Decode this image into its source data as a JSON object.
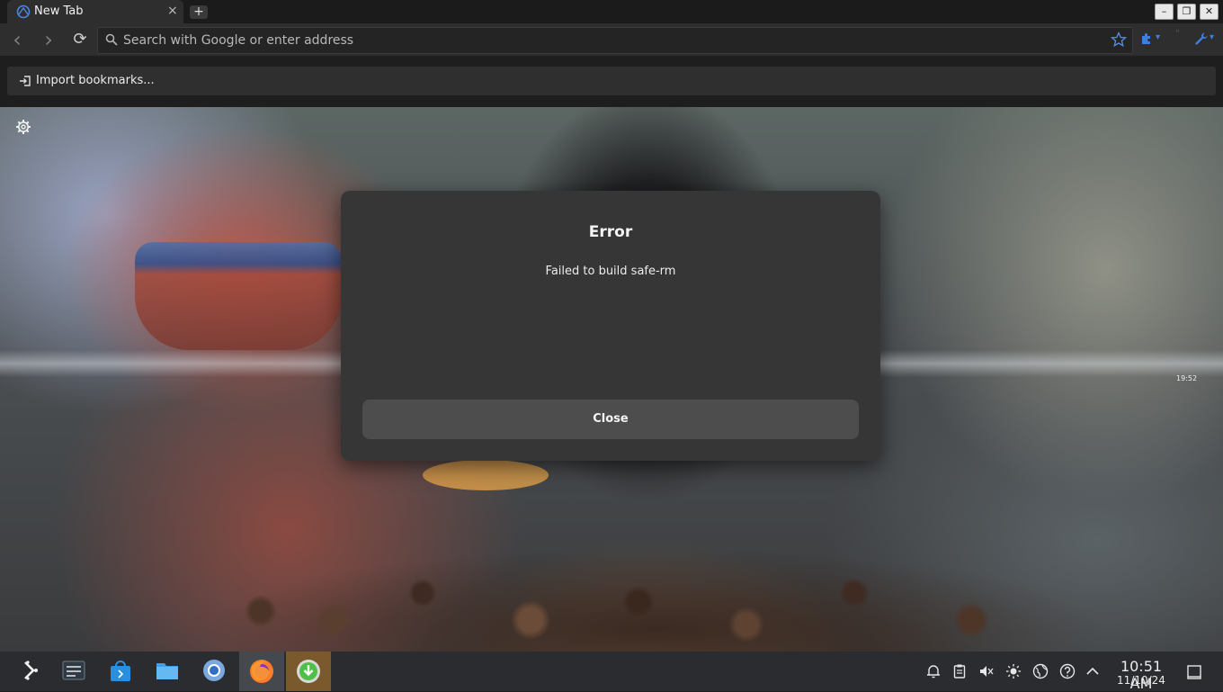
{
  "browser": {
    "tab": {
      "title": "New Tab",
      "close": "×"
    },
    "new_tab_label": "+",
    "window_controls": {
      "minimize": "–",
      "restore": "❐",
      "close": "✕"
    },
    "nav": {
      "back": "‹",
      "forward": "›",
      "reload": "⟳"
    },
    "address_bar": {
      "placeholder": "Search with Google or enter address",
      "value": ""
    },
    "extensions": {
      "puzzle": "▾",
      "wrench": "▾"
    },
    "bookmarks_bar": {
      "import_label": "Import bookmarks..."
    }
  },
  "dialog": {
    "title": "Error",
    "message": "Failed to build safe-rm",
    "close_label": "Close"
  },
  "wallpaper_clock": {
    "time": "19:52"
  },
  "taskbar": {
    "apps": [
      "application-launcher-icon",
      "system-settings-icon",
      "discover-store-icon",
      "dolphin-file-manager-icon",
      "chromium-icon",
      "firefox-icon",
      "download-manager-icon"
    ],
    "clock": {
      "time": "10:51 AM",
      "date": "11/10/24"
    }
  },
  "colors": {
    "chrome_bg": "#2e2e2e",
    "dialog_bg": "#363636",
    "taskbar_bg": "#2a2c2f",
    "accent": "#3d7fe0"
  }
}
